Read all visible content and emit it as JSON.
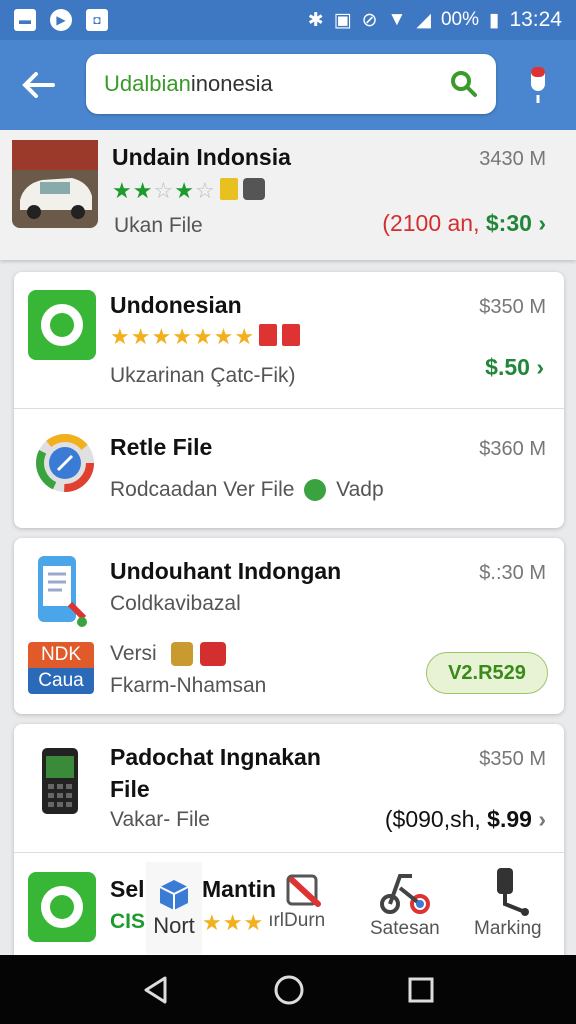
{
  "status_bar": {
    "battery": "00%",
    "time": "13:24",
    "icons": [
      "gallery-icon",
      "play-icon",
      "media-icon",
      "bluetooth-icon",
      "nfc-icon",
      "data-icon",
      "wifi-icon",
      "signal-icon",
      "battery-icon"
    ]
  },
  "header": {
    "search_value_green": "Udalbian",
    "search_value_rest": "inonesia",
    "icons": [
      "back-arrow-icon",
      "search-icon",
      "mic-icon"
    ]
  },
  "items": [
    {
      "title": "Undain Indonsia",
      "size": "3430 M",
      "subtitle": "Ukan File",
      "price_red": "(2100 an,",
      "price": "$:30",
      "rating": 3
    },
    {
      "title": "Undonesian",
      "size": "$350 M",
      "subtitle": "Ukzarinan Çatc-Fik)",
      "price": "$.50",
      "rating": 7
    },
    {
      "title": "Retle File",
      "size": "$360 M",
      "subtitle": "Rodcaadan Ver File",
      "extra": "Vadp"
    },
    {
      "title": "Undouhant Indongan",
      "size": "$.:30 M",
      "subtitle": "Coldkavibazal",
      "line3": "Versi",
      "line4": "Fkarm-Nhamsan",
      "badge": "V2.R529",
      "logo_top": "NDK",
      "logo_bottom": "Caua"
    },
    {
      "title_line1": "Padochat Ingnakan",
      "title_line2": "File",
      "size": "$350 M",
      "subtitle": "Vakar- File",
      "price_black": "($090,sh,",
      "price": "$.99"
    },
    {
      "title_a": "Sel",
      "title_b": "Mantin",
      "sub_a": "CIS",
      "sub_b": "ırlDurn"
    }
  ],
  "tabs": [
    {
      "label": "Nort"
    },
    {
      "label": "Satesan"
    },
    {
      "label": "Marking"
    }
  ],
  "nav": [
    "back-triangle-icon",
    "home-circle-icon",
    "recents-square-icon"
  ]
}
